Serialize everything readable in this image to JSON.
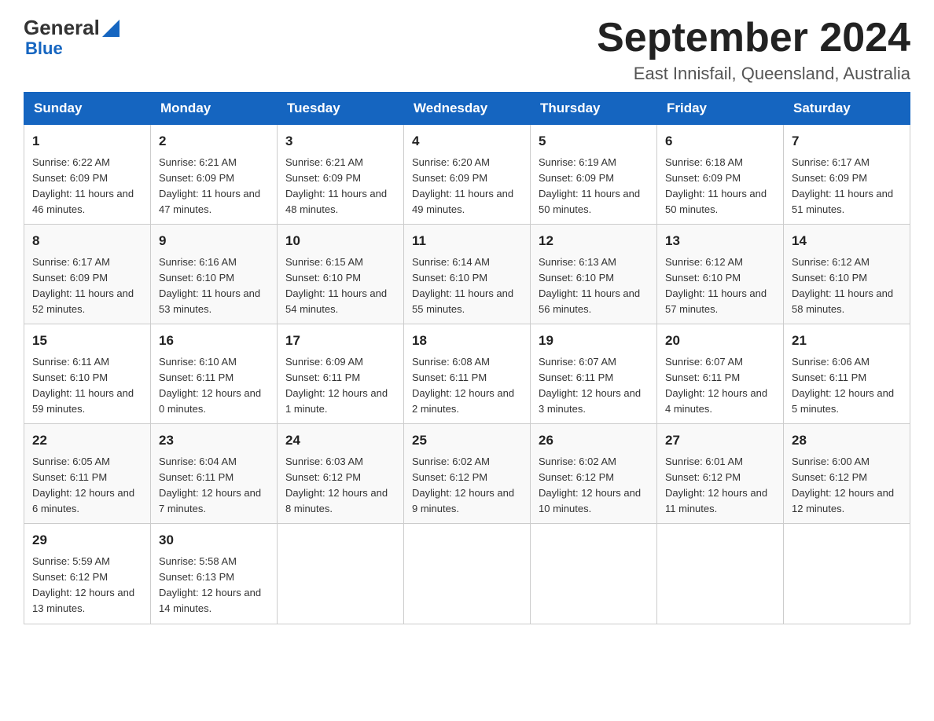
{
  "header": {
    "logo": {
      "part1": "General",
      "part2": "Blue"
    },
    "title": "September 2024",
    "subtitle": "East Innisfail, Queensland, Australia"
  },
  "days_of_week": [
    "Sunday",
    "Monday",
    "Tuesday",
    "Wednesday",
    "Thursday",
    "Friday",
    "Saturday"
  ],
  "weeks": [
    [
      {
        "day": "1",
        "sunrise": "6:22 AM",
        "sunset": "6:09 PM",
        "daylight": "11 hours and 46 minutes."
      },
      {
        "day": "2",
        "sunrise": "6:21 AM",
        "sunset": "6:09 PM",
        "daylight": "11 hours and 47 minutes."
      },
      {
        "day": "3",
        "sunrise": "6:21 AM",
        "sunset": "6:09 PM",
        "daylight": "11 hours and 48 minutes."
      },
      {
        "day": "4",
        "sunrise": "6:20 AM",
        "sunset": "6:09 PM",
        "daylight": "11 hours and 49 minutes."
      },
      {
        "day": "5",
        "sunrise": "6:19 AM",
        "sunset": "6:09 PM",
        "daylight": "11 hours and 50 minutes."
      },
      {
        "day": "6",
        "sunrise": "6:18 AM",
        "sunset": "6:09 PM",
        "daylight": "11 hours and 50 minutes."
      },
      {
        "day": "7",
        "sunrise": "6:17 AM",
        "sunset": "6:09 PM",
        "daylight": "11 hours and 51 minutes."
      }
    ],
    [
      {
        "day": "8",
        "sunrise": "6:17 AM",
        "sunset": "6:09 PM",
        "daylight": "11 hours and 52 minutes."
      },
      {
        "day": "9",
        "sunrise": "6:16 AM",
        "sunset": "6:10 PM",
        "daylight": "11 hours and 53 minutes."
      },
      {
        "day": "10",
        "sunrise": "6:15 AM",
        "sunset": "6:10 PM",
        "daylight": "11 hours and 54 minutes."
      },
      {
        "day": "11",
        "sunrise": "6:14 AM",
        "sunset": "6:10 PM",
        "daylight": "11 hours and 55 minutes."
      },
      {
        "day": "12",
        "sunrise": "6:13 AM",
        "sunset": "6:10 PM",
        "daylight": "11 hours and 56 minutes."
      },
      {
        "day": "13",
        "sunrise": "6:12 AM",
        "sunset": "6:10 PM",
        "daylight": "11 hours and 57 minutes."
      },
      {
        "day": "14",
        "sunrise": "6:12 AM",
        "sunset": "6:10 PM",
        "daylight": "11 hours and 58 minutes."
      }
    ],
    [
      {
        "day": "15",
        "sunrise": "6:11 AM",
        "sunset": "6:10 PM",
        "daylight": "11 hours and 59 minutes."
      },
      {
        "day": "16",
        "sunrise": "6:10 AM",
        "sunset": "6:11 PM",
        "daylight": "12 hours and 0 minutes."
      },
      {
        "day": "17",
        "sunrise": "6:09 AM",
        "sunset": "6:11 PM",
        "daylight": "12 hours and 1 minute."
      },
      {
        "day": "18",
        "sunrise": "6:08 AM",
        "sunset": "6:11 PM",
        "daylight": "12 hours and 2 minutes."
      },
      {
        "day": "19",
        "sunrise": "6:07 AM",
        "sunset": "6:11 PM",
        "daylight": "12 hours and 3 minutes."
      },
      {
        "day": "20",
        "sunrise": "6:07 AM",
        "sunset": "6:11 PM",
        "daylight": "12 hours and 4 minutes."
      },
      {
        "day": "21",
        "sunrise": "6:06 AM",
        "sunset": "6:11 PM",
        "daylight": "12 hours and 5 minutes."
      }
    ],
    [
      {
        "day": "22",
        "sunrise": "6:05 AM",
        "sunset": "6:11 PM",
        "daylight": "12 hours and 6 minutes."
      },
      {
        "day": "23",
        "sunrise": "6:04 AM",
        "sunset": "6:11 PM",
        "daylight": "12 hours and 7 minutes."
      },
      {
        "day": "24",
        "sunrise": "6:03 AM",
        "sunset": "6:12 PM",
        "daylight": "12 hours and 8 minutes."
      },
      {
        "day": "25",
        "sunrise": "6:02 AM",
        "sunset": "6:12 PM",
        "daylight": "12 hours and 9 minutes."
      },
      {
        "day": "26",
        "sunrise": "6:02 AM",
        "sunset": "6:12 PM",
        "daylight": "12 hours and 10 minutes."
      },
      {
        "day": "27",
        "sunrise": "6:01 AM",
        "sunset": "6:12 PM",
        "daylight": "12 hours and 11 minutes."
      },
      {
        "day": "28",
        "sunrise": "6:00 AM",
        "sunset": "6:12 PM",
        "daylight": "12 hours and 12 minutes."
      }
    ],
    [
      {
        "day": "29",
        "sunrise": "5:59 AM",
        "sunset": "6:12 PM",
        "daylight": "12 hours and 13 minutes."
      },
      {
        "day": "30",
        "sunrise": "5:58 AM",
        "sunset": "6:13 PM",
        "daylight": "12 hours and 14 minutes."
      },
      null,
      null,
      null,
      null,
      null
    ]
  ],
  "labels": {
    "sunrise_prefix": "Sunrise: ",
    "sunset_prefix": "Sunset: ",
    "daylight_prefix": "Daylight: "
  }
}
